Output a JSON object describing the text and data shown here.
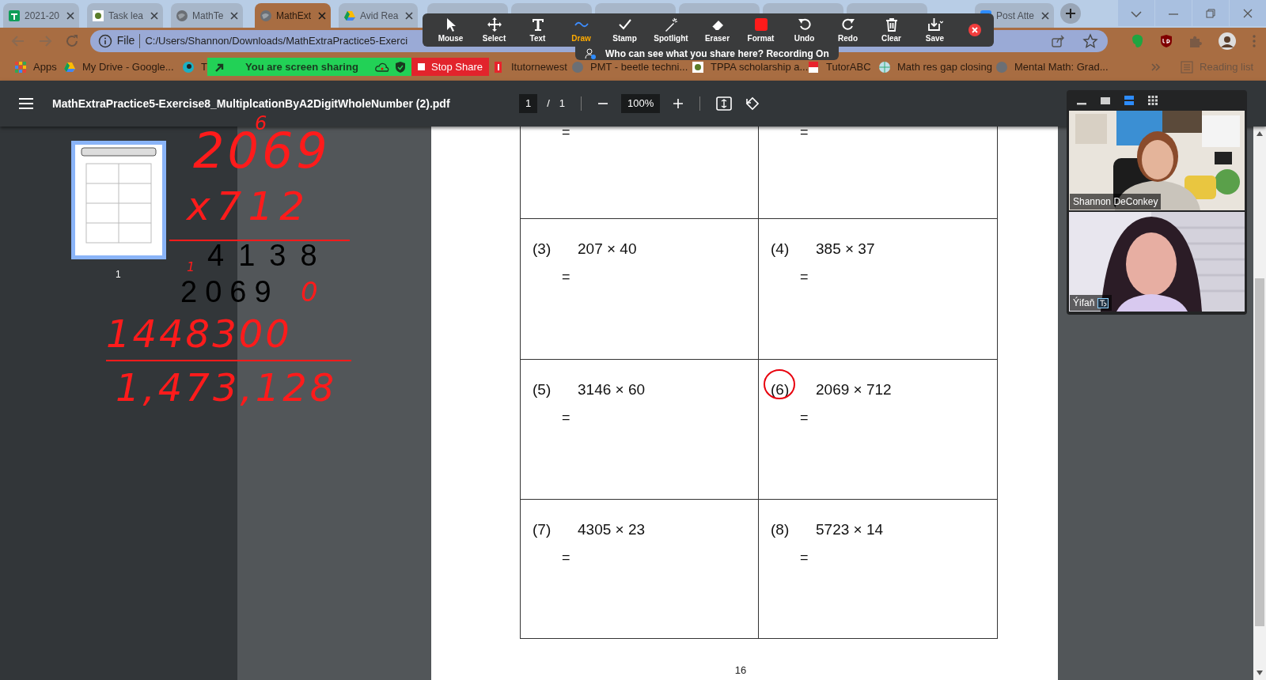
{
  "browser_tabs": [
    {
      "title": "2021-20",
      "selected": false
    },
    {
      "title": "Task lea",
      "selected": false
    },
    {
      "title": "MathTe",
      "selected": false
    },
    {
      "title": "MathExt",
      "selected": true
    },
    {
      "title": "Avid Rea",
      "selected": false
    },
    {
      "title": "Post Atte",
      "selected": false
    }
  ],
  "address_bar": {
    "scheme": "File",
    "url": "C:/Users/Shannon/Downloads/MathExtraPractice5-Exerci"
  },
  "bookmarks": [
    {
      "title": "Apps"
    },
    {
      "title": "My Drive - Google..."
    },
    {
      "title": "T"
    },
    {
      "title": "Itutornewest"
    },
    {
      "title": "PMT - beetle techni..."
    },
    {
      "title": "TPPA scholarship a..."
    },
    {
      "title": "TutorABC"
    },
    {
      "title": "Math res gap closing"
    },
    {
      "title": "Mental Math: Grad..."
    }
  ],
  "reading_list": "Reading list",
  "screen_share": {
    "message": "You are screen sharing",
    "stop": "Stop Share"
  },
  "annotation_tools": [
    {
      "label": "Mouse",
      "selected": false
    },
    {
      "label": "Select",
      "selected": false
    },
    {
      "label": "Text",
      "selected": false
    },
    {
      "label": "Draw",
      "selected": true
    },
    {
      "label": "Stamp",
      "selected": false
    },
    {
      "label": "Spotlight",
      "selected": false
    },
    {
      "label": "Eraser",
      "selected": false
    },
    {
      "label": "Format",
      "selected": false
    },
    {
      "label": "Undo",
      "selected": false
    },
    {
      "label": "Redo",
      "selected": false
    },
    {
      "label": "Clear",
      "selected": false
    },
    {
      "label": "Save",
      "selected": false
    }
  ],
  "share_notice": "Who can see what you share here? Recording On",
  "pdf": {
    "title": "MathExtraPractice5-Exercise8_MultiplcationByA2DigitWholeNumber (2).pdf",
    "page": "1",
    "separator": "/",
    "pages": "1",
    "zoom": "100%"
  },
  "thumbnail": {
    "label": "1",
    "selected": true
  },
  "handwriting": [
    {
      "kind": "ink",
      "text": "6"
    },
    {
      "kind": "ink",
      "text": "2069"
    },
    {
      "kind": "ink",
      "text": "x712"
    },
    {
      "kind": "typed",
      "text": "4138"
    },
    {
      "kind": "ink",
      "text": "1"
    },
    {
      "kind": "typed",
      "text": "2069"
    },
    {
      "kind": "ink",
      "text": "0"
    },
    {
      "kind": "ink",
      "text": "1448300"
    },
    {
      "kind": "ink",
      "text": "1,473,128"
    }
  ],
  "problems": [
    {
      "equals": "=",
      "circled": false
    },
    {
      "equals": "=",
      "circled": false
    },
    {
      "number": "(3)",
      "expression": "207 × 40",
      "equals": "=",
      "circled": false
    },
    {
      "number": "(4)",
      "expression": "385 × 37",
      "equals": "=",
      "circled": false
    },
    {
      "number": "(5)",
      "expression": "3146 × 60",
      "equals": "=",
      "circled": false
    },
    {
      "number": "(6)",
      "expression": "2069 × 712",
      "equals": "=",
      "circled": true
    },
    {
      "number": "(7)",
      "expression": "4305 × 23",
      "equals": "=",
      "circled": false
    },
    {
      "number": "(8)",
      "expression": "5723 × 14",
      "equals": "=",
      "circled": false
    }
  ],
  "page_number": "16",
  "video_views": [
    {
      "selected": false
    },
    {
      "selected": false
    },
    {
      "selected": true
    },
    {
      "selected": false
    }
  ],
  "participants": [
    {
      "name": "Shannon DeConkey"
    },
    {
      "name": "Ýifaň"
    }
  ]
}
